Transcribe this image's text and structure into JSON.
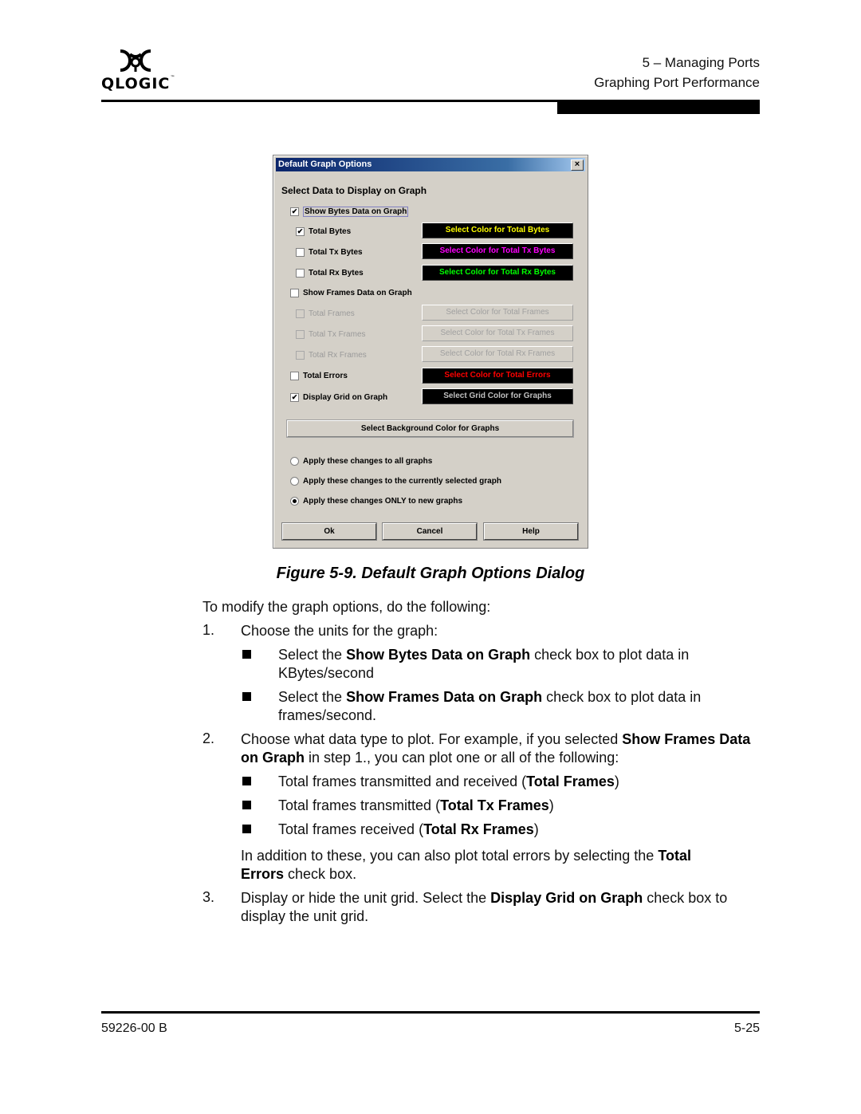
{
  "header": {
    "logo_text": "QLOGIC",
    "logo_tm": "™",
    "chapter": "5 – Managing Ports",
    "section": "Graphing Port Performance"
  },
  "dialog": {
    "title": "Default Graph Options",
    "close_icon": "×",
    "section_title": "Select Data to Display on Graph",
    "show_bytes": {
      "label": "Show Bytes Data on Graph",
      "checked": true
    },
    "total_bytes": {
      "label": "Total Bytes",
      "checked": true,
      "button": "Select Color for Total Bytes",
      "color": "#ffff00"
    },
    "total_tx_bytes": {
      "label": "Total Tx Bytes",
      "checked": false,
      "button": "Select Color for Total Tx Bytes",
      "color": "#ff00ff"
    },
    "total_rx_bytes": {
      "label": "Total Rx Bytes",
      "checked": false,
      "button": "Select Color for Total Rx Bytes",
      "color": "#00ff00"
    },
    "show_frames": {
      "label": "Show Frames Data on Graph",
      "checked": false
    },
    "total_frames": {
      "label": "Total Frames",
      "checked": false,
      "disabled": true,
      "button": "Select Color for Total Frames"
    },
    "total_tx_frames": {
      "label": "Total Tx Frames",
      "checked": false,
      "disabled": true,
      "button": "Select Color for Total Tx Frames"
    },
    "total_rx_frames": {
      "label": "Total Rx Frames",
      "checked": false,
      "disabled": true,
      "button": "Select Color for Total Rx Frames"
    },
    "total_errors": {
      "label": "Total Errors",
      "checked": false,
      "button": "Select Color for Total Errors",
      "color": "#ff0000"
    },
    "display_grid": {
      "label": "Display Grid on Graph",
      "checked": true,
      "button": "Select Grid Color for Graphs",
      "color": "#c0c0c0"
    },
    "bg_button": "Select Background Color for Graphs",
    "radios": [
      {
        "label": "Apply these changes to all graphs",
        "selected": false
      },
      {
        "label": "Apply these changes to the currently selected graph",
        "selected": false
      },
      {
        "label": "Apply these changes ONLY to new graphs",
        "selected": true
      }
    ],
    "buttons": {
      "ok": "Ok",
      "cancel": "Cancel",
      "help": "Help"
    },
    "check_mark": "✔"
  },
  "caption": "Figure 5-9.  Default Graph Options Dialog",
  "body": {
    "intro": "To modify the graph options, do the following:",
    "step1": {
      "num": "1.",
      "text": "Choose the units for the graph:",
      "bullets": [
        {
          "pre": "Select the ",
          "bold": "Show Bytes Data on Graph",
          "post": " check box to plot data in KBytes/second"
        },
        {
          "pre": "Select the ",
          "bold": "Show Frames Data on Graph",
          "post": " check box to plot data in frames/second."
        }
      ]
    },
    "step2": {
      "num": "2.",
      "pre": "Choose what data type to plot. For example, if you selected ",
      "bold": "Show Frames Data on Graph",
      "post": " in step 1., you can plot one or all of the following:",
      "bullets": [
        {
          "pre": "Total frames transmitted and received (",
          "bold": "Total Frames",
          "post": ")"
        },
        {
          "pre": "Total frames transmitted (",
          "bold": "Total Tx Frames",
          "post": ")"
        },
        {
          "pre": "Total frames received (",
          "bold": "Total Rx Frames",
          "post": ")"
        }
      ],
      "note_pre": "In addition to these, you can also plot total errors by selecting the ",
      "note_bold": "Total Errors",
      "note_post": " check box."
    },
    "step3": {
      "num": "3.",
      "pre": "Display or hide the unit grid. Select the ",
      "bold": "Display Grid on Graph",
      "post": " check box to display the unit grid."
    }
  },
  "footer": {
    "doc_number": "59226-00 B",
    "page_number": "5-25"
  }
}
